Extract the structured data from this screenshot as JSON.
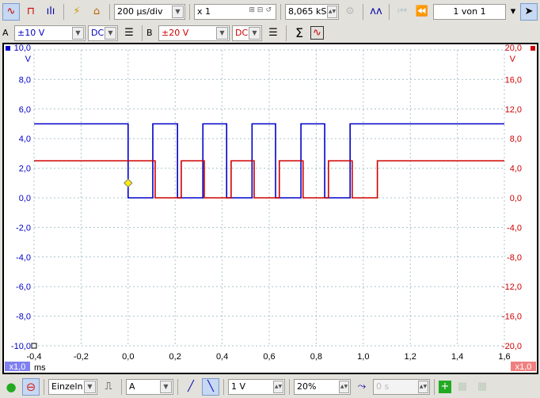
{
  "toolbar": {
    "icons": [
      "scope-mode-icon",
      "persistence-mode-icon",
      "spectrum-mode-icon",
      "auto-setup-icon",
      "home-icon"
    ],
    "timebase": "200 µs/div",
    "zoom": "x 1",
    "samples": "8,065 kS",
    "buffer": "1 von 1"
  },
  "channels": {
    "a": {
      "label": "A",
      "range": "±10 V",
      "coupling": "DC",
      "color": "#0000c8"
    },
    "b": {
      "label": "B",
      "range": "±20 V",
      "coupling": "DC",
      "color": "#d00000"
    },
    "math_icon": "Σ"
  },
  "plot": {
    "left_unit": "V",
    "right_unit": "V",
    "x_unit": "ms",
    "left_zoom": "x1,0",
    "right_zoom": "x1,0",
    "left_ticks": [
      "10,0",
      "8,0",
      "6,0",
      "4,0",
      "2,0",
      "0,0",
      "-2,0",
      "-4,0",
      "-6,0",
      "-8,0",
      "-10,0"
    ],
    "right_ticks": [
      "20,0",
      "16,0",
      "12,0",
      "8,0",
      "4,0",
      "0,0",
      "-4,0",
      "-8,0",
      "-12,0",
      "-16,0",
      "-20,0"
    ],
    "x_ticks": [
      "-0,4",
      "-0,2",
      "0,0",
      "0,2",
      "0,4",
      "0,6",
      "0,8",
      "1,0",
      "1,2",
      "1,4",
      "1,6"
    ]
  },
  "chart_data": {
    "type": "line",
    "xlim": [
      -0.4,
      1.6
    ],
    "xlabel": "ms",
    "grid": true,
    "series": [
      {
        "name": "A",
        "axis": "left",
        "ylim": [
          -10,
          10
        ],
        "color": "#0000c8",
        "high": 5.0,
        "low": 0.0,
        "start_level": "high",
        "edges_ms": [
          0.0,
          0.105,
          0.21,
          0.318,
          0.419,
          0.527,
          0.627,
          0.735,
          0.836,
          0.944
        ]
      },
      {
        "name": "B",
        "axis": "right",
        "ylim": [
          -20,
          20
        ],
        "color": "#d00000",
        "high": 5.0,
        "low": 0.0,
        "start_level": "high",
        "edges_ms": [
          0.115,
          0.226,
          0.324,
          0.438,
          0.536,
          0.643,
          0.744,
          0.852,
          0.953,
          1.06
        ]
      }
    ],
    "trigger": {
      "t_ms": 0.0,
      "level_v": 1.0,
      "channel": "A"
    }
  },
  "bottom": {
    "mode": "Einzeln",
    "source": "A",
    "threshold": "1 V",
    "pretrigger": "20%",
    "delay": "0 s"
  }
}
